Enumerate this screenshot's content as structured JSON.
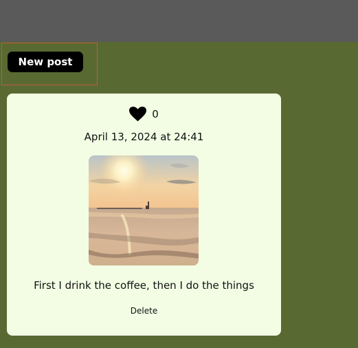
{
  "header": {},
  "actions": {
    "new_post_label": "New post"
  },
  "post": {
    "likes": "0",
    "date": "April 13, 2024 at 24:41",
    "caption": "First I drink the coffee, then I do the things",
    "delete_label": "Delete"
  },
  "icons": {
    "heart": "heart-icon"
  },
  "colors": {
    "top_bar": "#5a5a5a",
    "background": "#586a31",
    "card": "#f2fde4",
    "button": "#000000",
    "button_text": "#ffffff",
    "selection_outline": "#c45a3e"
  }
}
